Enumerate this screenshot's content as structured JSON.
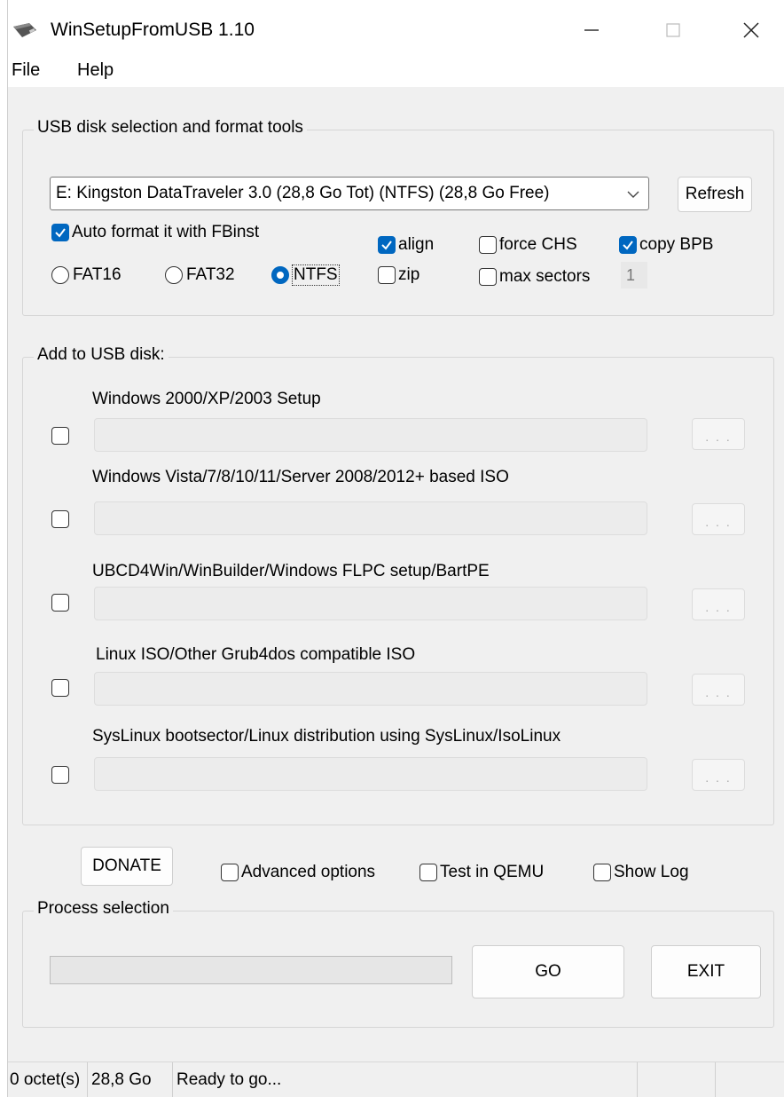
{
  "window": {
    "title": "WinSetupFromUSB 1.10"
  },
  "menu": {
    "file": "File",
    "help": "Help"
  },
  "usb_group": {
    "label": "USB disk selection and format tools",
    "disk_value": "E: Kingston DataTraveler 3.0 (28,8 Go Tot) (NTFS) (28,8 Go Free)",
    "refresh": "Refresh",
    "auto_format": "Auto format it with FBinst",
    "auto_format_checked": true,
    "fat16": "FAT16",
    "fat32": "FAT32",
    "ntfs": "NTFS",
    "selected_fs": "NTFS",
    "align": "align",
    "align_checked": true,
    "force_chs": "force CHS",
    "force_chs_checked": false,
    "copy_bpb": "copy BPB",
    "copy_bpb_checked": true,
    "zip": "zip",
    "zip_checked": false,
    "max_sectors": "max sectors",
    "max_sectors_checked": false,
    "max_sectors_value": "1"
  },
  "add_group": {
    "label": "Add to USB disk:",
    "items": [
      {
        "label": "Windows 2000/XP/2003 Setup",
        "browse": ". . ."
      },
      {
        "label": "Windows Vista/7/8/10/11/Server 2008/2012+ based ISO",
        "browse": ". . ."
      },
      {
        "label": "UBCD4Win/WinBuilder/Windows FLPC setup/BartPE",
        "browse": ". . ."
      },
      {
        "label": "Linux ISO/Other Grub4dos compatible ISO",
        "browse": ". . ."
      },
      {
        "label": "SysLinux bootsector/Linux distribution using SysLinux/IsoLinux",
        "browse": ". . ."
      }
    ]
  },
  "options": {
    "donate": "DONATE",
    "advanced": "Advanced options",
    "qemu": "Test in QEMU",
    "show_log": "Show Log"
  },
  "process": {
    "label": "Process selection",
    "go": "GO",
    "exit": "EXIT",
    "progress": 0
  },
  "status": {
    "size": "0 octet(s)",
    "free": "28,8 Go",
    "message": "Ready to go..."
  },
  "colors": {
    "accent": "#0067c0",
    "window_bg": "#f0f0f0"
  },
  "icons": {
    "app": "usb-drive-icon",
    "check": "check-icon",
    "chevron": "chevron-down-icon"
  }
}
